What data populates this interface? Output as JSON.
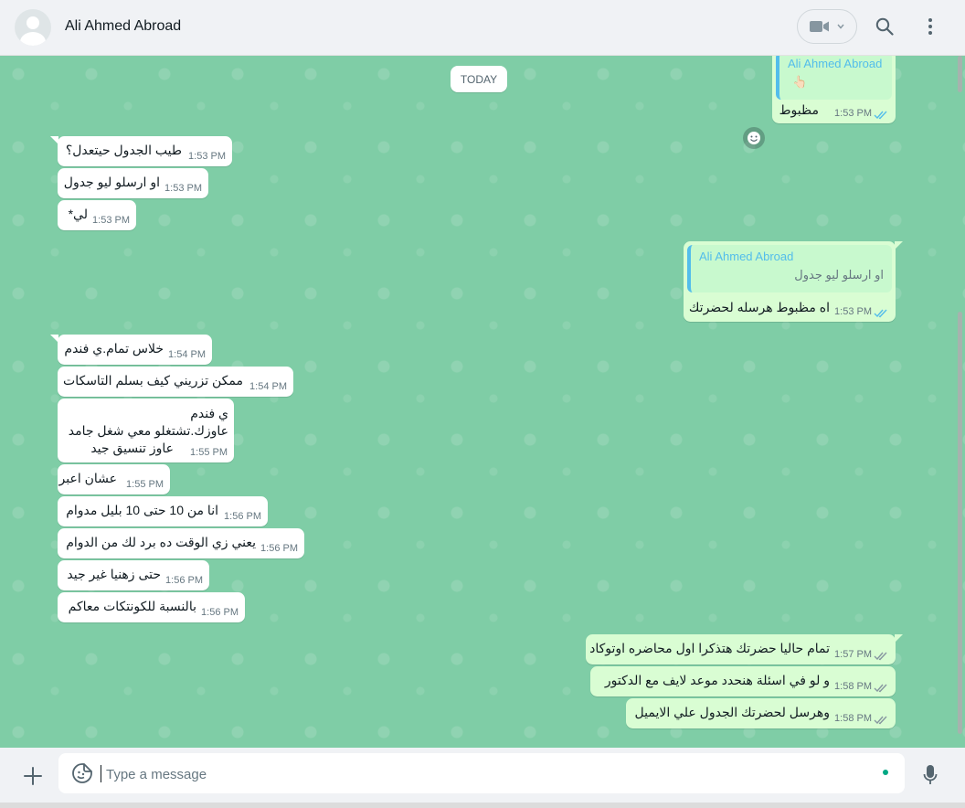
{
  "header": {
    "contact_name": "Ali Ahmed Abroad",
    "icons": {
      "avatar": "default-avatar",
      "video": "video-camera-icon",
      "search": "search-icon",
      "menu": "kebab-menu-icon"
    }
  },
  "chat": {
    "date_label": "TODAY",
    "reaction_icon": "smiley-icon",
    "top_reply": {
      "author": "Ali Ahmed Abroad",
      "quoted": "👆🏻",
      "text": "مظبوط",
      "time": "1:53 PM"
    },
    "group1": [
      {
        "text": "طيب الجدول حيتعدل؟",
        "time": "1:53 PM"
      },
      {
        "text": "او ارسلو ليو جدول",
        "time": "1:53 PM"
      },
      {
        "text": "لي*",
        "time": "1:53 PM"
      }
    ],
    "reply2": {
      "author": "Ali Ahmed Abroad",
      "quoted": "او ارسلو ليو جدول",
      "text": "اه مظبوط هرسله لحضرتك",
      "time": "1:53 PM"
    },
    "group2": [
      {
        "text": "خلاس تمام.ي فندم",
        "time": "1:54 PM"
      },
      {
        "text": "ممكن تزريني كيف بسلم التاسكات",
        "time": "1:54 PM"
      },
      {
        "lines": [
          "ي فندم",
          "عاوزك.تشتغلو معي شغل جامد",
          "عاوز تنسيق جيد"
        ],
        "time": "1:55 PM"
      },
      {
        "text": "عشان اعبر",
        "time": "1:55 PM"
      },
      {
        "text": "انا من 10 حتى 10 بليل مدوام",
        "time": "1:56 PM"
      },
      {
        "text": "يعني زي الوقت ده برد لك من الدوام",
        "time": "1:56 PM"
      },
      {
        "text": "حتى زهنيا غير جيد",
        "time": "1:56 PM"
      },
      {
        "text": "بالنسبة للكونتكات معاكم",
        "time": "1:56 PM"
      }
    ],
    "group3": [
      {
        "text": "تمام حاليا حضرتك هتذكرا اول محاضره اوتوكاد",
        "time": "1:57 PM"
      },
      {
        "text": "و لو في اسئلة هنحدد موعد لايف مع الدكتور",
        "time": "1:58 PM"
      },
      {
        "text": "وهرسل لحضرتك الجدول علي الايميل",
        "time": "1:58 PM"
      }
    ]
  },
  "composer": {
    "placeholder": "Type a message",
    "icons": {
      "attach": "plus-icon",
      "sticker": "sticker-icon",
      "mic": "microphone-icon"
    }
  },
  "colors": {
    "chat_bg": "#7fcda6",
    "outgoing": "#d9fdd3",
    "incoming": "#ffffff",
    "ticks": "#53bdeb"
  }
}
